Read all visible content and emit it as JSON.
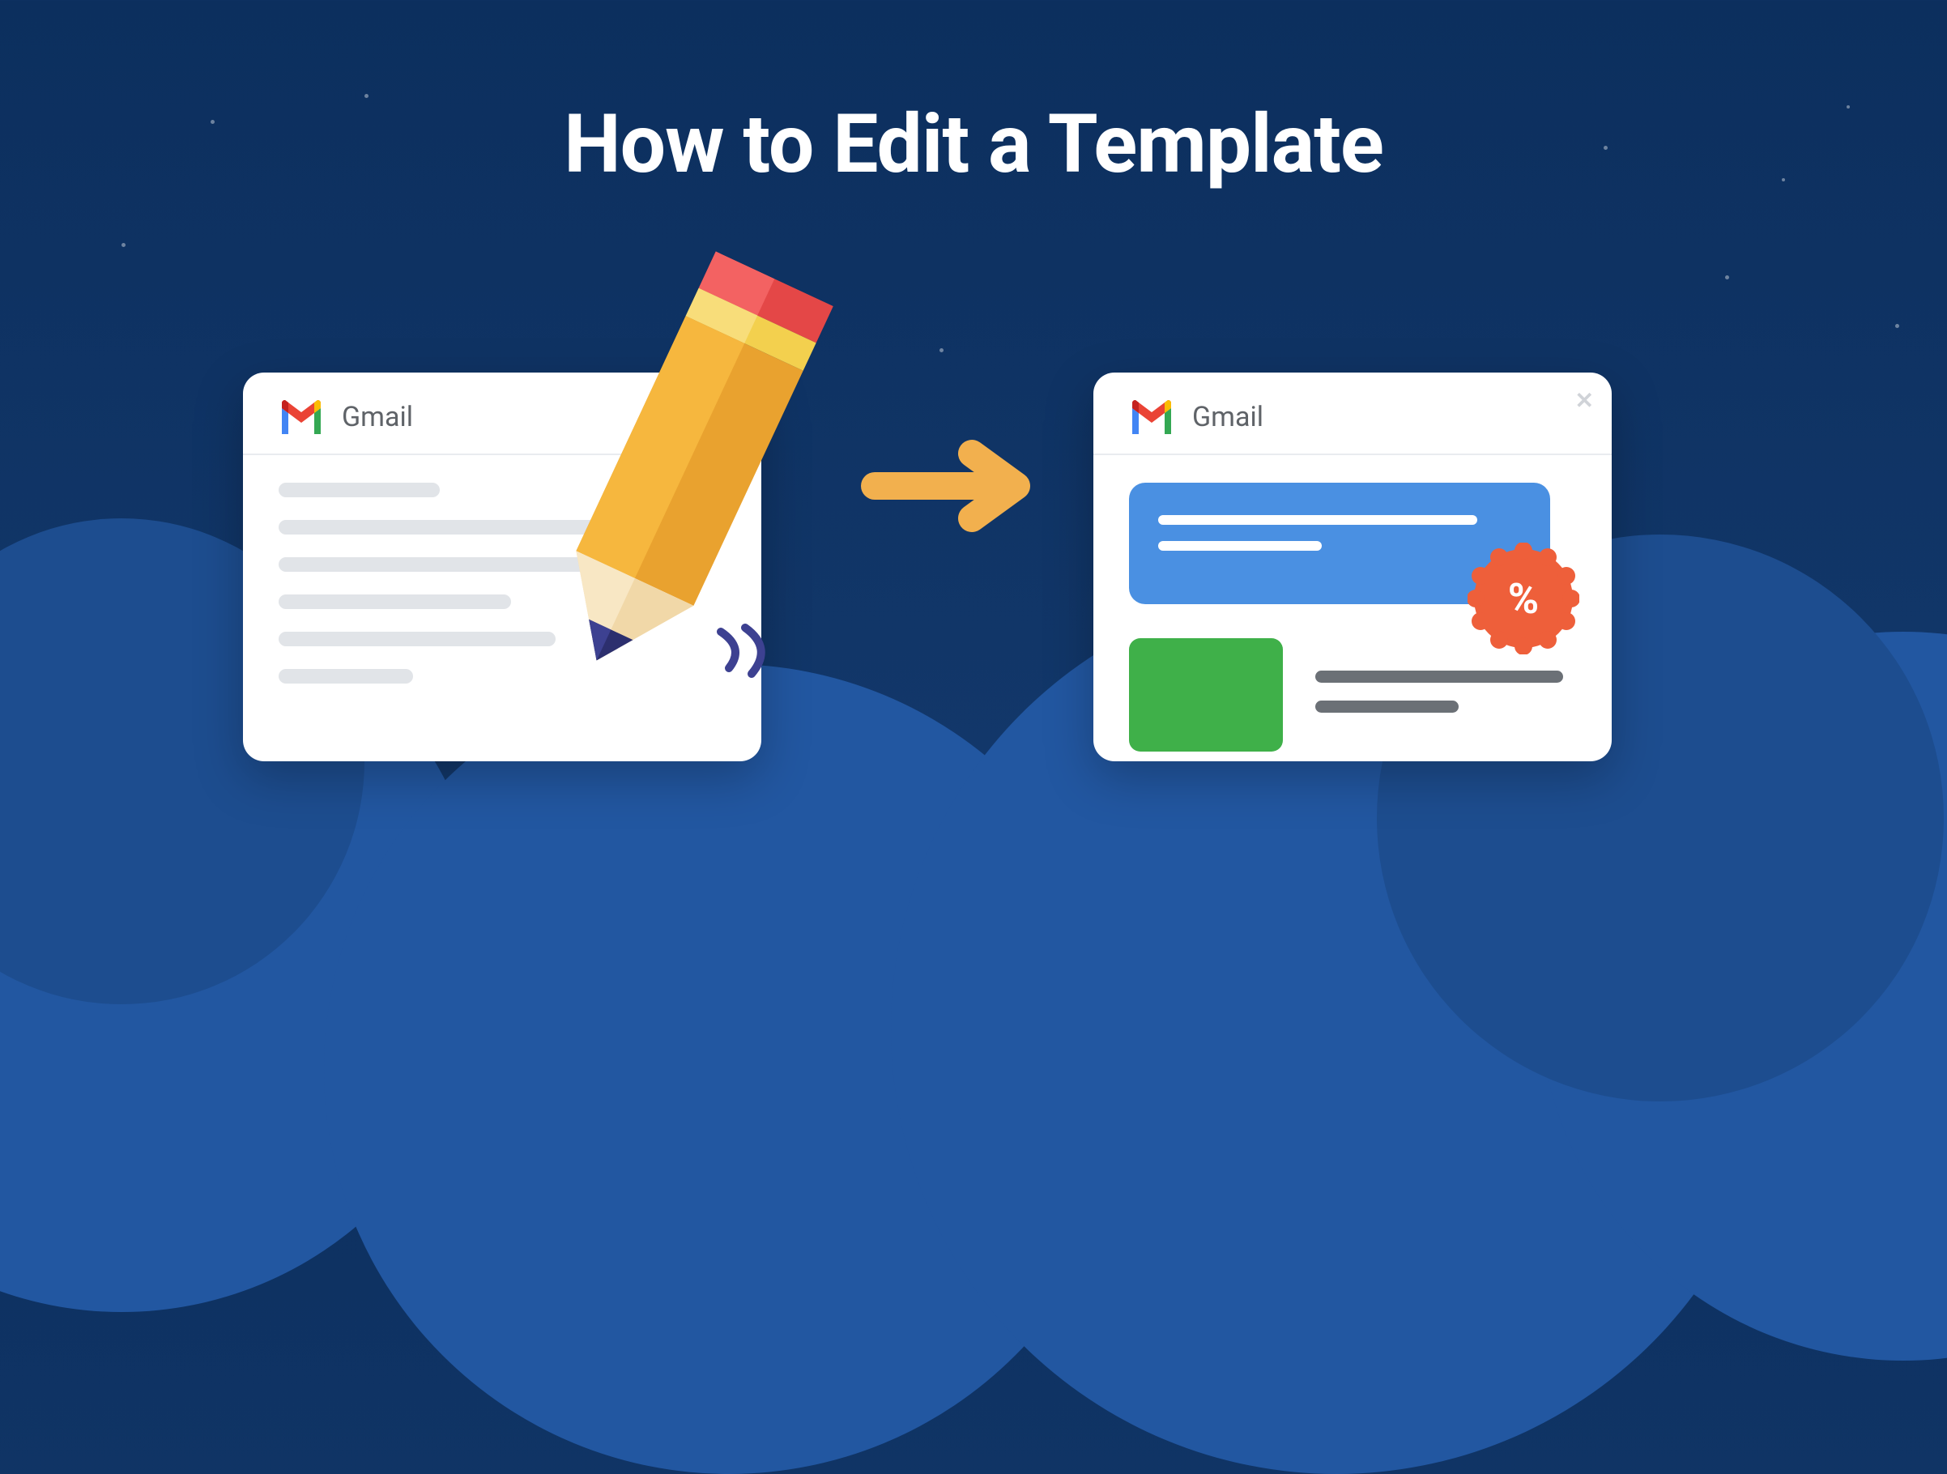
{
  "title": "How to Edit a Template",
  "gmail_label": "Gmail",
  "percent_symbol": "%",
  "colors": {
    "bg_top": "#0c2f5e",
    "bg_bottom": "#143a6e",
    "cloud": "#2257a1",
    "arrow": "#f2b04e",
    "pencil_body": "#f6b73e",
    "pencil_eraser": "#e44747",
    "blue_block": "#4a90e2",
    "green_block": "#3fb049",
    "badge": "#ee5f3a"
  }
}
